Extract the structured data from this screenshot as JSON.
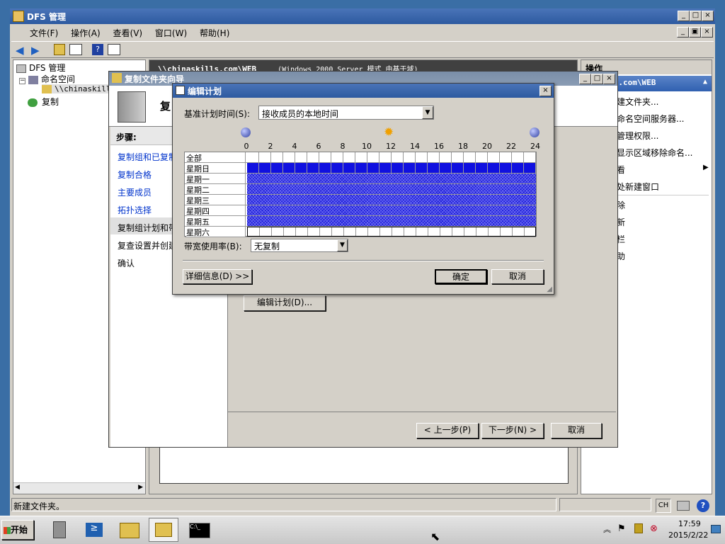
{
  "main_window": {
    "title": "DFS 管理"
  },
  "menu": [
    "文件(F)",
    "操作(A)",
    "查看(V)",
    "窗口(W)",
    "帮助(H)"
  ],
  "tree": {
    "root": "DFS 管理",
    "namespaces": "命名空间",
    "ns_item": "\\\\chinaskill",
    "replication": "复制"
  },
  "center_header": {
    "path": "\\\\chinaskills.com\\WEB",
    "mode": "(Windows 2000 Server 模式 由基于域)"
  },
  "actions": {
    "title": "操作",
    "subtitle": "askills.com\\WEB",
    "items": [
      "建文件夹...",
      "命名空间服务器...",
      "管理权限...",
      "显示区域移除命名...",
      "看",
      "处新建窗口",
      "除",
      "新",
      "栏",
      "助"
    ]
  },
  "status_bar": "新建文件夹。",
  "wizard": {
    "title": "复制文件夹向导",
    "heading": "复",
    "steps_label": "步骤:",
    "steps": [
      "复制组和已复制",
      "复制合格",
      "主要成员",
      "拓扑选择",
      "复制组计划和带",
      "复查设置并创建",
      "确认"
    ],
    "edit_schedule_btn": "编辑计划(D)...",
    "prev": "< 上一步(P)",
    "next": "下一步(N) >",
    "cancel": "取消"
  },
  "dialog": {
    "title": "编辑计划",
    "base_time_label": "基准计划时间(S):",
    "base_time_value": "接收成员的本地时间",
    "hours": [
      "0",
      "2",
      "4",
      "6",
      "8",
      "10",
      "12",
      "14",
      "16",
      "18",
      "20",
      "22",
      "24"
    ],
    "days": [
      "全部",
      "星期日",
      "星期一",
      "星期二",
      "星期三",
      "星期四",
      "星期五",
      "星期六"
    ],
    "day_states": [
      "header",
      "full",
      "full",
      "full",
      "full",
      "full",
      "full",
      "none"
    ],
    "bandwidth_label": "带宽使用率(B):",
    "bandwidth_value": "无复制",
    "details_btn": "详细信息(D) >>",
    "ok": "确定",
    "cancel": "取消"
  },
  "taskbar": {
    "start": "开始",
    "lang": "CH",
    "time": "17:59",
    "date": "2015/2/22"
  },
  "colors": {
    "desktop": "#3a6ea5",
    "title": "#2d5aa0",
    "schedule": "#1010e0"
  }
}
